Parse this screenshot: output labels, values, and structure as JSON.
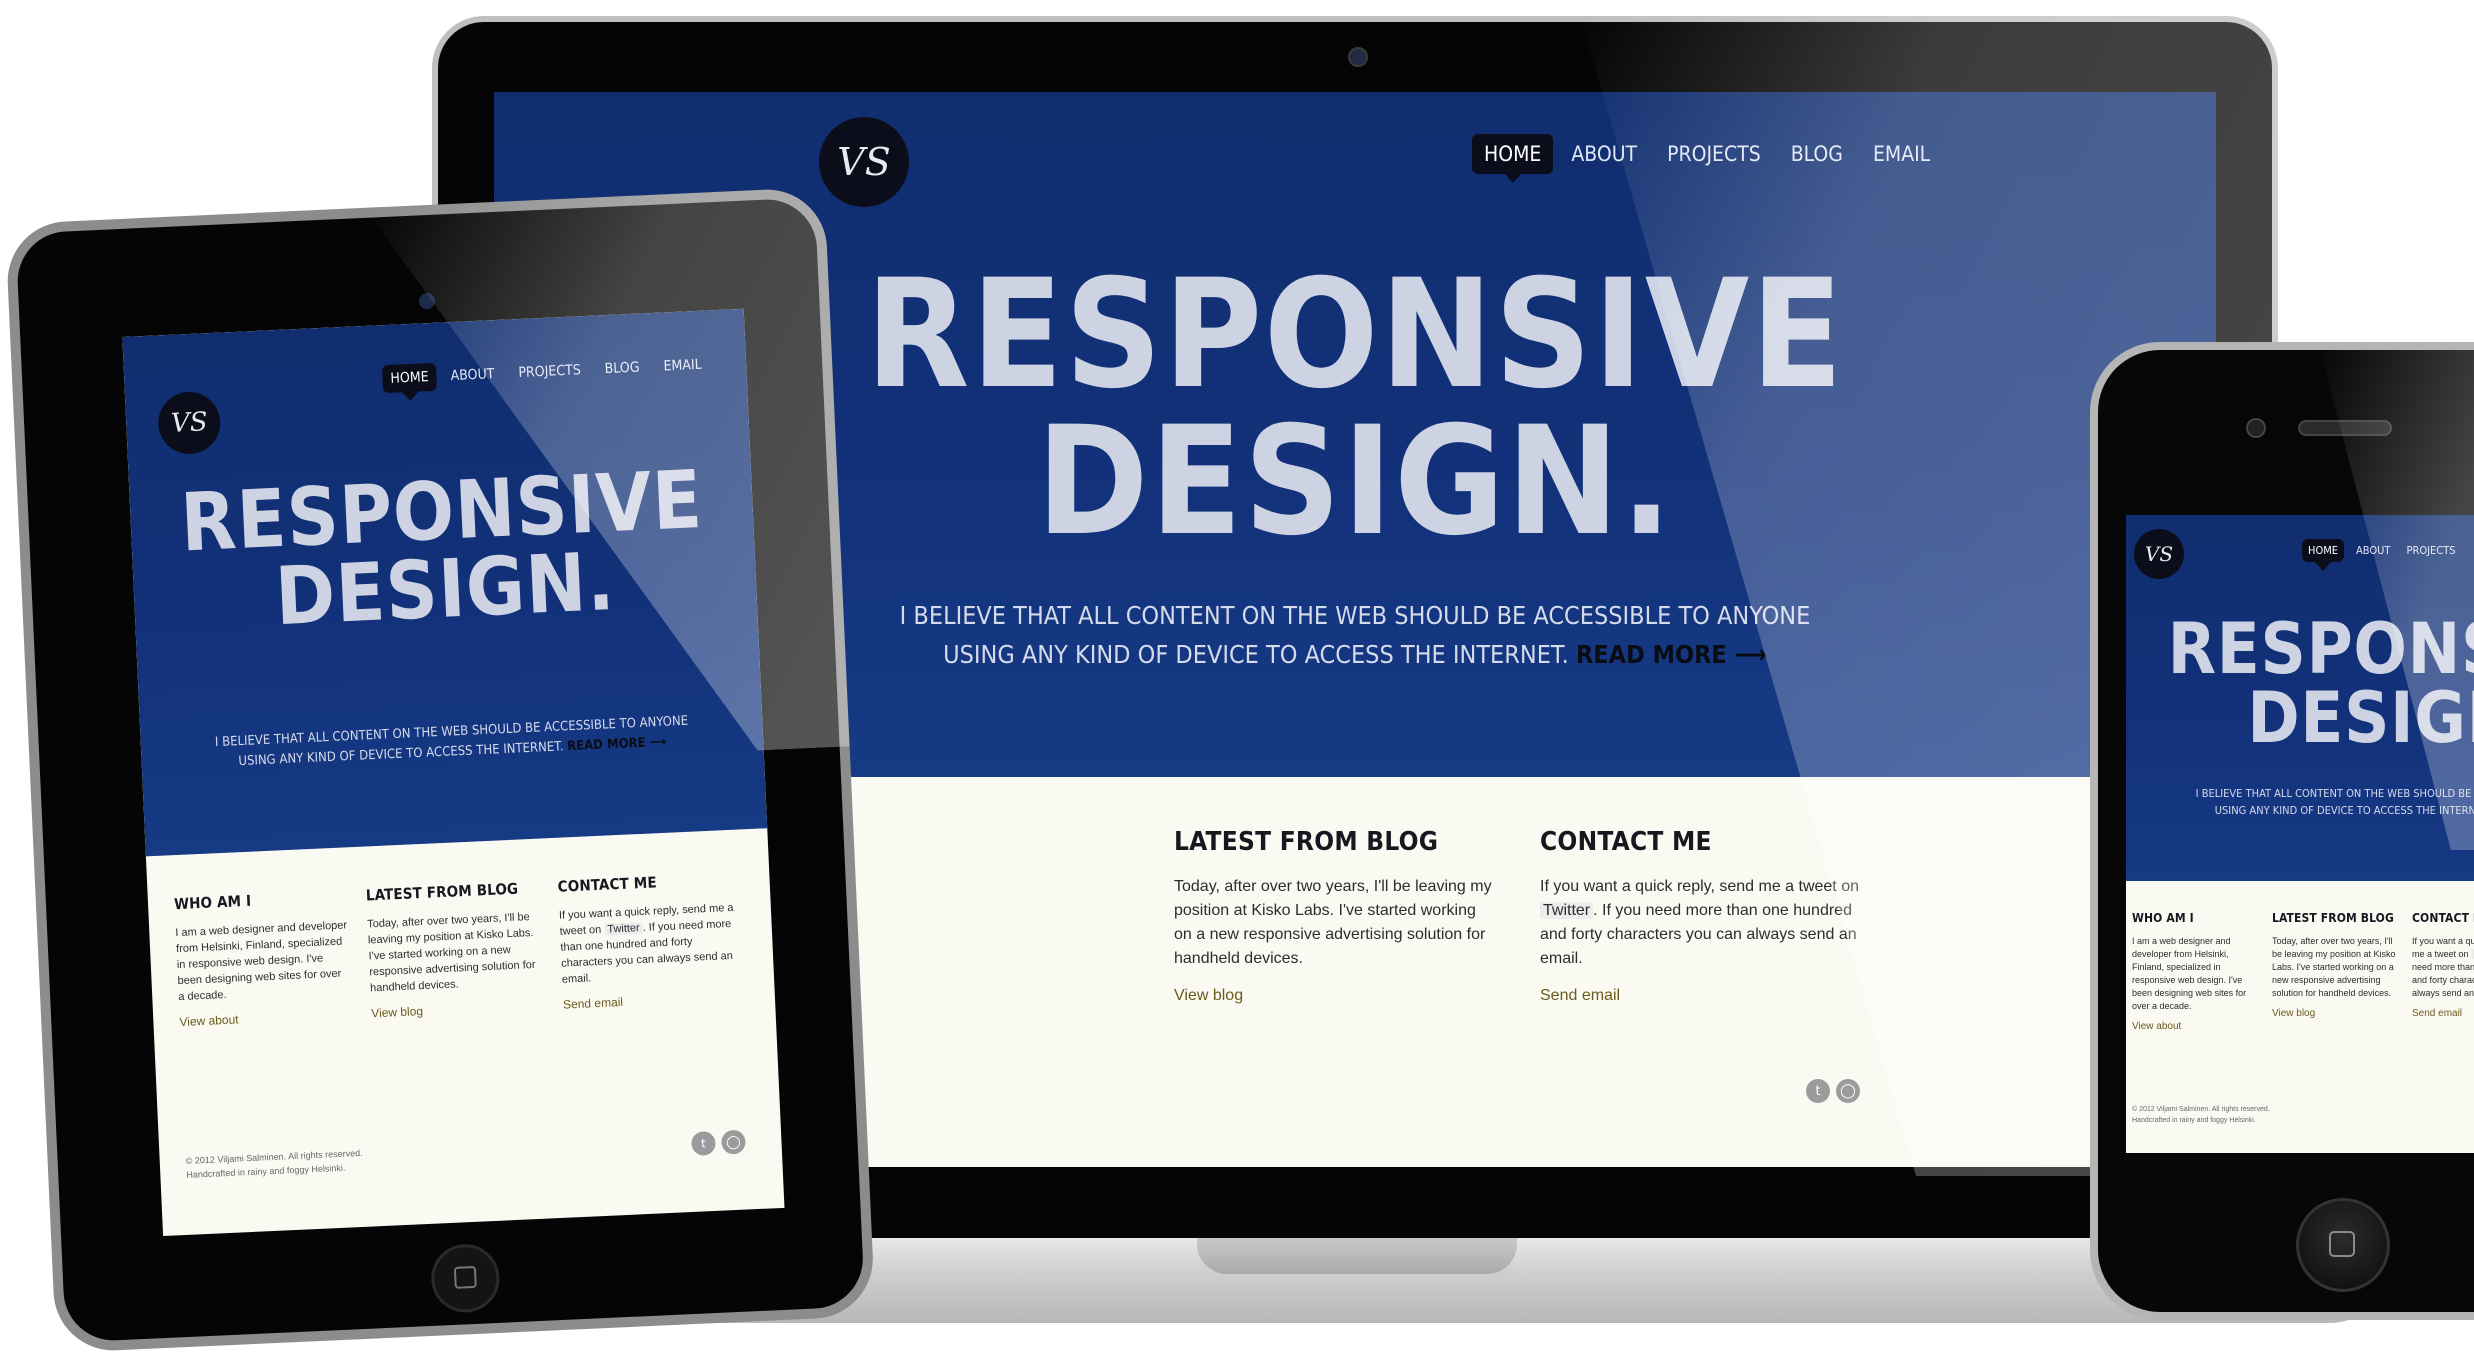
{
  "site": {
    "logo_text": "VS",
    "nav": [
      "Home",
      "About",
      "Projects",
      "Blog",
      "Email"
    ],
    "headline_line1": "RESPONSIVE",
    "headline_line2": "DESIGN.",
    "tagline_line1": "I BELIEVE THAT ALL CONTENT ON THE WEB SHOULD BE ACCESSIBLE TO ANYONE",
    "tagline_line2": "USING ANY KIND OF DEVICE TO ACCESS THE INTERNET.",
    "read_more": "READ MORE ⟶",
    "columns": [
      {
        "title": "Who am I",
        "text": "I am a web designer and developer from Helsinki, Finland, specialized in responsive web design. I've been designing web sites for over a decade.",
        "link": "View about"
      },
      {
        "title": "Latest from blog",
        "text": "Today, after over two years, I'll be leaving my position at Kisko Labs. I've started working on a new responsive advertising solution for handheld devices.",
        "link": "View blog"
      },
      {
        "title": "Contact me",
        "text_before": "If you want a quick reply, send me a tweet on ",
        "twitter": "Twitter",
        "text_after": ". If you need more than one hundred and forty characters you can always send an email.",
        "link": "Send email"
      }
    ],
    "footer_line1": "© 2012 Viljami Salminen. All rights reserved.",
    "footer_line2": "Handcrafted in rainy and foggy Helsinki.",
    "social_icons": [
      "twitter-icon",
      "dribbble-icon"
    ]
  },
  "colors": {
    "hero": "#12317a",
    "content_bg": "#fbfaf2",
    "link": "#6b5a1d"
  }
}
